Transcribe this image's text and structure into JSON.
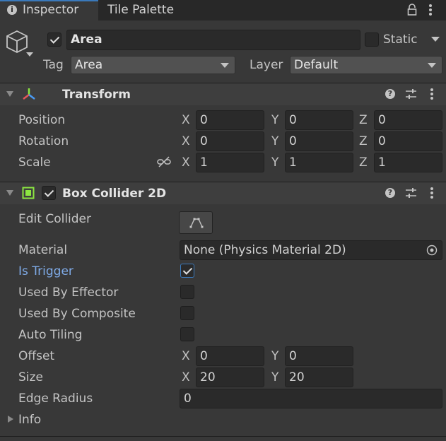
{
  "tabs": [
    {
      "label": "Inspector",
      "icon": "info-icon"
    },
    {
      "label": "Tile Palette"
    }
  ],
  "object": {
    "name": "Area",
    "active": true,
    "static_label": "Static",
    "static_checked": false,
    "tag_label": "Tag",
    "tag_value": "Area",
    "layer_label": "Layer",
    "layer_value": "Default"
  },
  "transform": {
    "title": "Transform",
    "rows": [
      {
        "label": "Position",
        "x": "0",
        "y": "0",
        "z": "0"
      },
      {
        "label": "Rotation",
        "x": "0",
        "y": "0",
        "z": "0"
      },
      {
        "label": "Scale",
        "x": "1",
        "y": "1",
        "z": "1"
      }
    ],
    "axis": {
      "x": "X",
      "y": "Y",
      "z": "Z"
    }
  },
  "box_collider": {
    "title": "Box Collider 2D",
    "enabled": true,
    "edit_collider_label": "Edit Collider",
    "material_label": "Material",
    "material_value": "None (Physics Material 2D)",
    "is_trigger_label": "Is Trigger",
    "is_trigger": true,
    "used_by_effector_label": "Used By Effector",
    "used_by_effector": false,
    "used_by_composite_label": "Used By Composite",
    "used_by_composite": false,
    "auto_tiling_label": "Auto Tiling",
    "auto_tiling": false,
    "offset_label": "Offset",
    "offset_x": "0",
    "offset_y": "0",
    "size_label": "Size",
    "size_x": "20",
    "size_y": "20",
    "edge_radius_label": "Edge Radius",
    "edge_radius_value": "0",
    "info_label": "Info"
  },
  "colors": {
    "background": "#383838",
    "tab_accent": "#3a79bb",
    "is_trigger_label": "#7fabe8",
    "collider_icon": "#8ce641"
  }
}
